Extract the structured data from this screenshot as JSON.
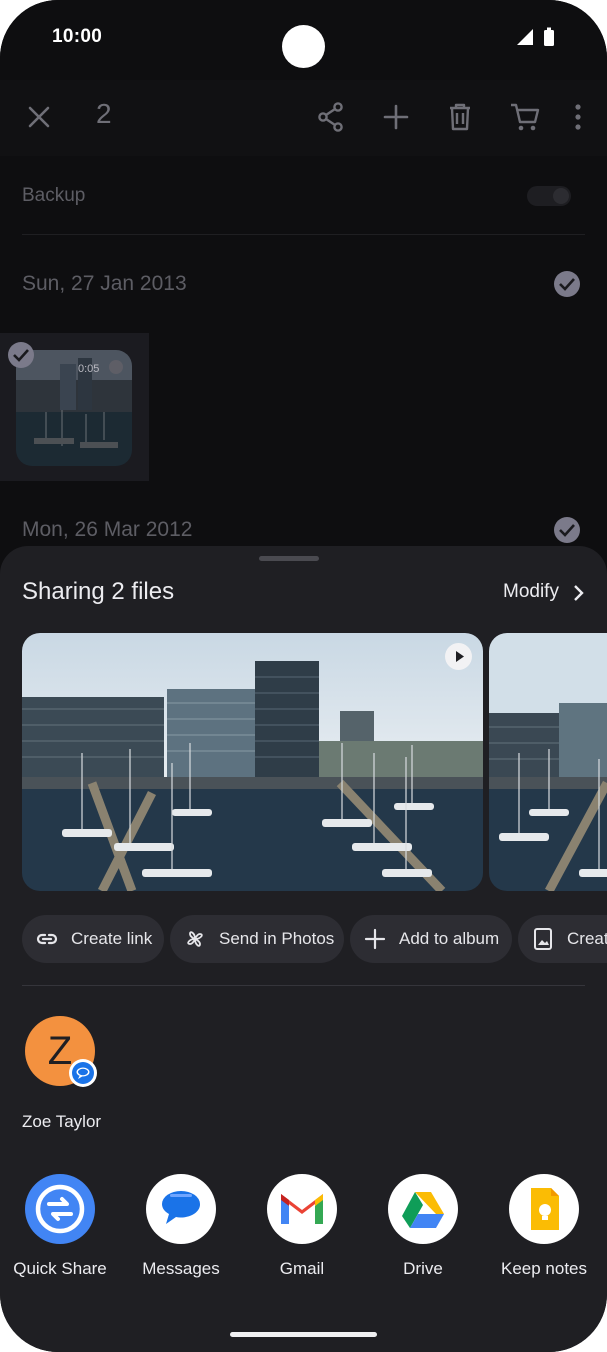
{
  "status_bar": {
    "time": "10:00"
  },
  "app_bar": {
    "selected_count": "2"
  },
  "background": {
    "backup_label": "Backup",
    "date_1": "Sun, 27 Jan 2013",
    "video_duration": "0:05",
    "date_2": "Mon, 26 Mar 2012"
  },
  "sheet": {
    "title": "Sharing 2 files",
    "modify_label": "Modify",
    "actions": [
      {
        "label": "Create link",
        "icon": "link-icon"
      },
      {
        "label": "Send in Photos",
        "icon": "pinwheel-icon"
      },
      {
        "label": "Add to album",
        "icon": "plus-icon"
      },
      {
        "label": "Creat",
        "icon": "photo-album-icon"
      }
    ],
    "contact": {
      "initial": "Z",
      "name": "Zoe Taylor"
    },
    "apps": [
      {
        "label": "Quick Share",
        "icon": "quick-share-icon"
      },
      {
        "label": "Messages",
        "icon": "messages-icon"
      },
      {
        "label": "Gmail",
        "icon": "gmail-icon"
      },
      {
        "label": "Drive",
        "icon": "drive-icon"
      },
      {
        "label": "Keep notes",
        "icon": "keep-notes-icon"
      }
    ]
  },
  "colors": {
    "sheet_bg": "#1f1f23",
    "chip_bg": "#2d2d33",
    "avatar": "#f3913f",
    "quick_share": "#4285f4"
  }
}
